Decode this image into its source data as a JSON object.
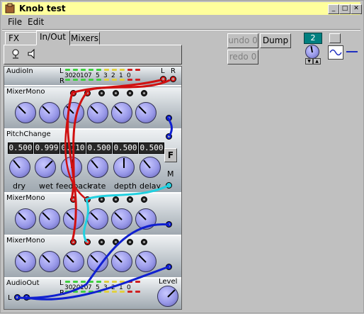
{
  "window": {
    "title": "Knob test"
  },
  "colors": {
    "title_bg": "#ffff9c",
    "lcd_bg": "#282828",
    "counter_bg": "#008080"
  },
  "menu": {
    "file": "File",
    "edit": "Edit"
  },
  "tabs": {
    "fx": "FX",
    "inout": "In/Out",
    "mixers": "Mixers"
  },
  "toolbar": {
    "undo": "undo 0",
    "redo": "redo 0",
    "dump": "Dump",
    "counter": "2"
  },
  "modules": {
    "audioin": {
      "name": "AudioIn",
      "l": "L",
      "r": "R",
      "ticks": [
        "30",
        "20",
        "10",
        "7",
        "5",
        "3",
        "2",
        "1",
        "0"
      ]
    },
    "mixer1": {
      "name": "MixerMono"
    },
    "pitch": {
      "name": "PitchChange",
      "values": [
        "0.500",
        "0.999",
        "0.710",
        "0.500",
        "0.500",
        "0.500"
      ],
      "labels": [
        "dry",
        "wet",
        "feedback",
        "rate",
        "depth",
        "delay"
      ],
      "f_button": "F",
      "m_label": "M"
    },
    "mixer2": {
      "name": "MixerMono"
    },
    "mixer3": {
      "name": "MixerMono"
    },
    "audioout": {
      "name": "AudioOut",
      "l": "L",
      "r": "R",
      "level": "Level",
      "ticks": [
        "30",
        "20",
        "10",
        "7",
        "5",
        "3",
        "2",
        "1",
        "0"
      ]
    }
  }
}
